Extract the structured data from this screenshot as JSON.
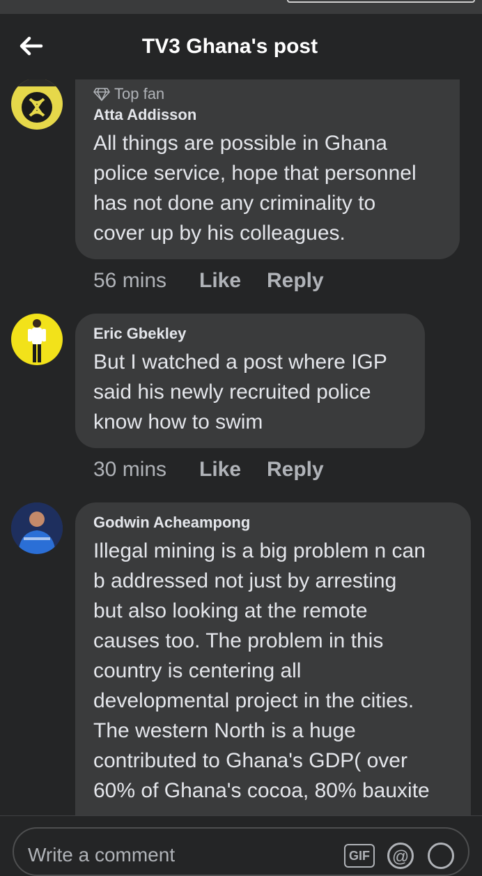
{
  "header": {
    "title": "TV3 Ghana's post"
  },
  "comments": [
    {
      "badge": "Top fan",
      "author": "Atta Addisson",
      "text": "All things are possible in Ghana\npolice service, hope that personnel\nhas not done any criminality to\ncover up by his colleagues.",
      "time": "56 mins",
      "like": "Like",
      "reply": "Reply"
    },
    {
      "author": "Eric Gbekley",
      "text": "But I watched a post where IGP\nsaid his newly recruited police\nknow how to swim",
      "time": "30 mins",
      "like": "Like",
      "reply": "Reply"
    },
    {
      "author": "Godwin Acheampong",
      "text": "Illegal mining is a big problem n can\nb addressed not just by arresting\nbut also looking at the remote\ncauses too. The problem in this\ncountry is centering all\ndevelopmental project in the cities.\nThe western North is a huge\ncontributed to Ghana's GDP( over\n60% of Ghana's cocoa, 80% bauxite"
    }
  ],
  "composer": {
    "placeholder": "Write a comment",
    "gif": "GIF",
    "at": "@"
  }
}
